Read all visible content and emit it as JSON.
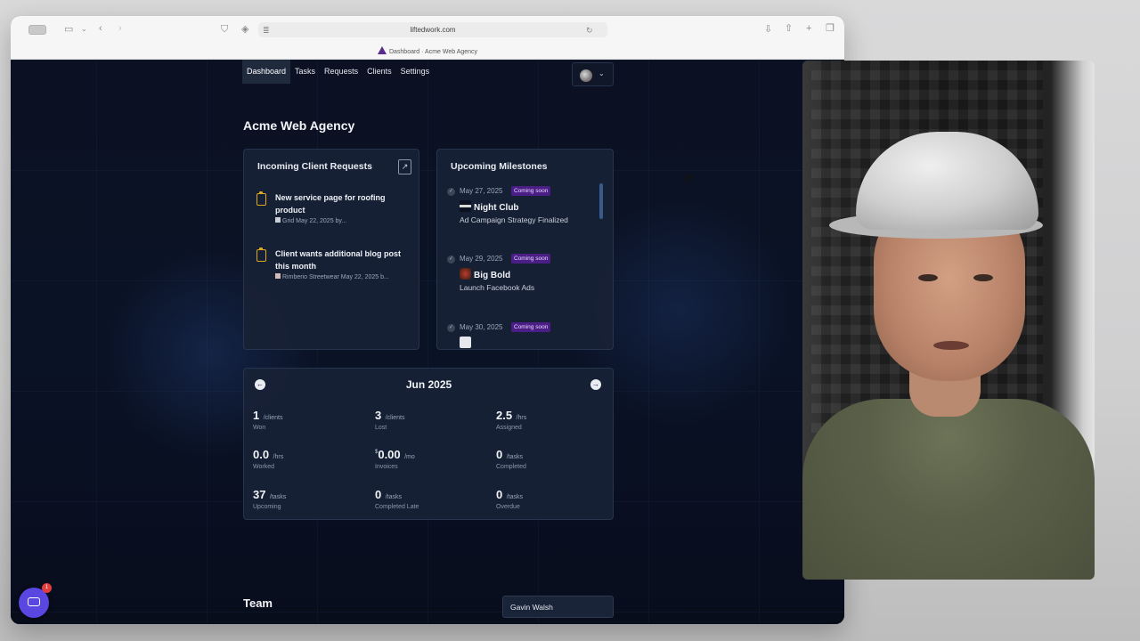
{
  "browser": {
    "url": "liftedwork.com",
    "tab_title": "Dashboard · Acme Web Agency"
  },
  "nav": {
    "items": [
      "Dashboard",
      "Tasks",
      "Requests",
      "Clients",
      "Settings"
    ],
    "active": "Dashboard"
  },
  "page": {
    "title": "Acme Web Agency"
  },
  "requests": {
    "title": "Incoming Client Requests",
    "items": [
      {
        "title": "New service page for roofing product",
        "meta": "Grid May 22, 2025 by..."
      },
      {
        "title": "Client wants additional blog post this month",
        "meta": "Rimberio Streetwear May 22, 2025 b..."
      }
    ]
  },
  "milestones": {
    "title": "Upcoming Milestones",
    "items": [
      {
        "date": "May 27, 2025",
        "badge": "Coming soon",
        "client": "Night Club",
        "desc": "Ad Campaign Strategy Finalized"
      },
      {
        "date": "May 29, 2025",
        "badge": "Coming soon",
        "client": "Big Bold",
        "desc": "Launch Facebook Ads"
      },
      {
        "date": "May 30, 2025",
        "badge": "Coming soon",
        "client": "",
        "desc": ""
      }
    ]
  },
  "calendar": {
    "month": "Jun 2025",
    "stats": [
      {
        "value": "1",
        "unit": "/clients",
        "label": "Won"
      },
      {
        "value": "3",
        "unit": "/clients",
        "label": "Lost"
      },
      {
        "value": "2.5",
        "unit": "/hrs",
        "label": "Assigned"
      },
      {
        "value": "0.0",
        "unit": "/hrs",
        "label": "Worked"
      },
      {
        "value": "0.00",
        "unit": "/mo",
        "label": "Invoices",
        "currency": "$"
      },
      {
        "value": "0",
        "unit": "/tasks",
        "label": "Completed"
      },
      {
        "value": "37",
        "unit": "/tasks",
        "label": "Upcoming"
      },
      {
        "value": "0",
        "unit": "/tasks",
        "label": "Completed Late"
      },
      {
        "value": "0",
        "unit": "/tasks",
        "label": "Overdue"
      }
    ]
  },
  "team": {
    "title": "Team",
    "selected_member": "Gavin Walsh"
  },
  "chat": {
    "badge_count": "1"
  },
  "colors": {
    "accent": "#5a46e0",
    "badge": "#4b1e86",
    "page_bg": "#0a1020"
  }
}
